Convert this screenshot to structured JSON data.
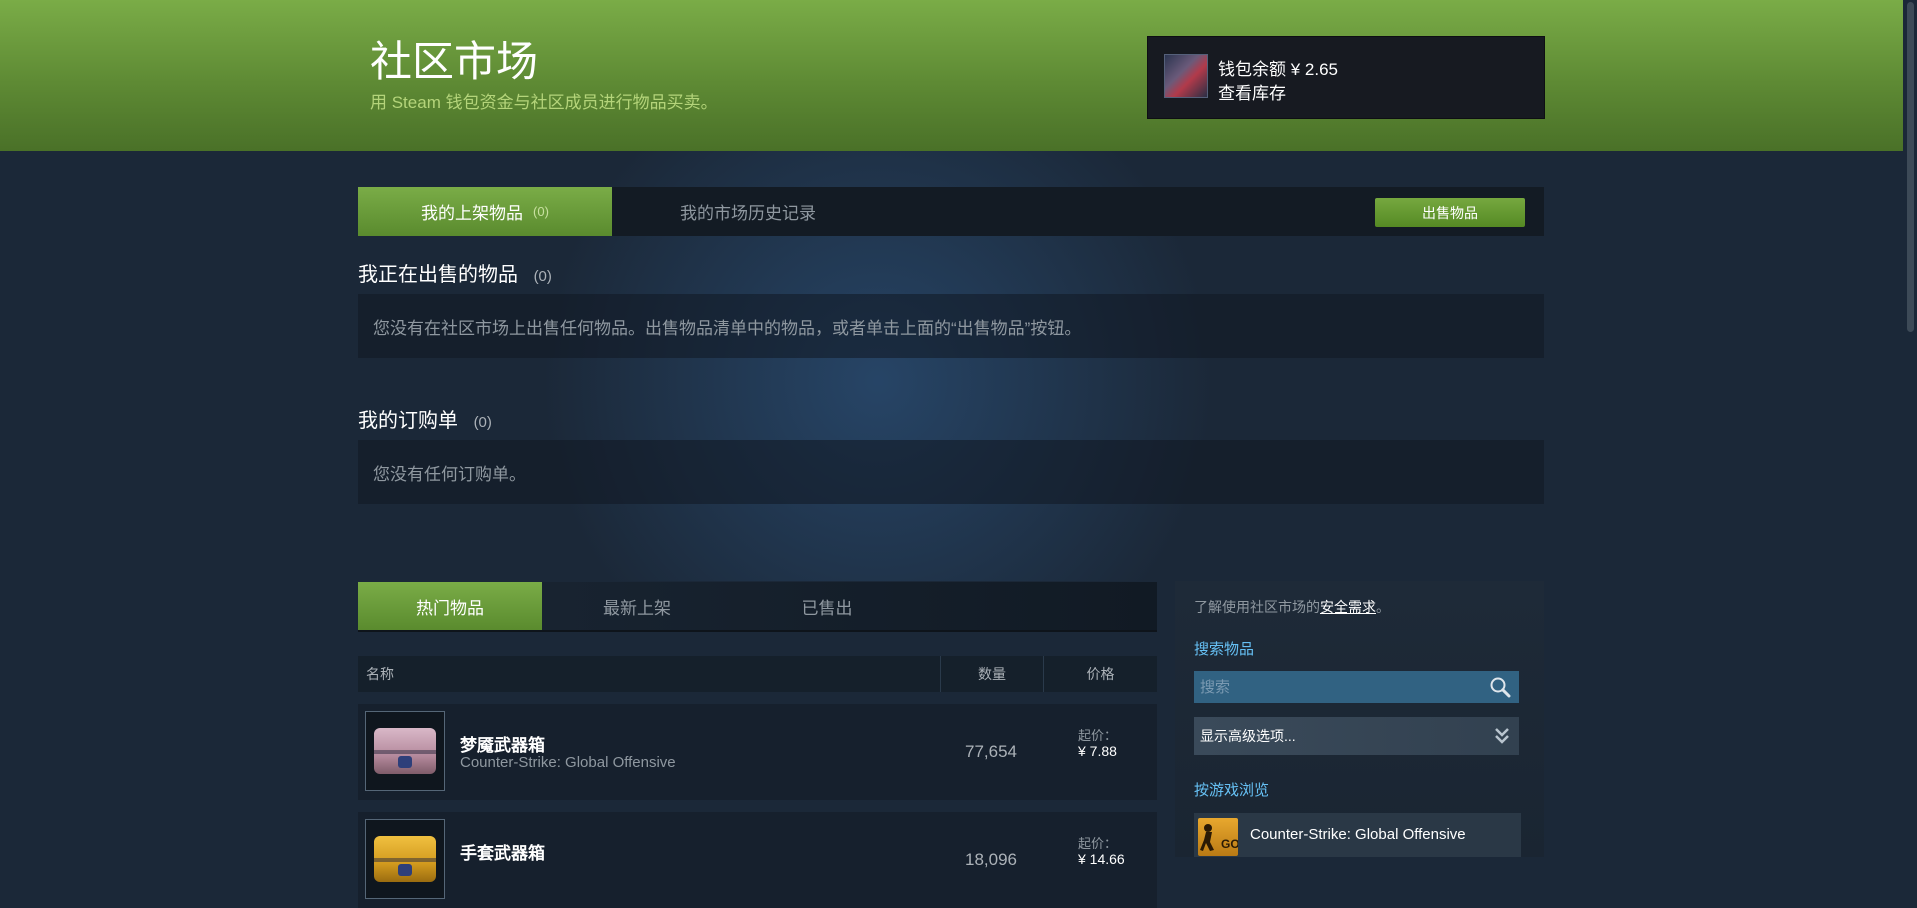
{
  "header": {
    "title": "社区市场",
    "subtitle": "用 Steam 钱包资金与社区成员进行物品买卖。",
    "wallet_label": "钱包余额 ¥ 2.65",
    "inventory_link": "查看库存"
  },
  "listing_tabs": {
    "my_listings": "我的上架物品",
    "my_listings_count": "(0)",
    "history": "我的市场历史记录",
    "sell_button": "出售物品"
  },
  "selling_section": {
    "title": "我正在出售的物品",
    "count": "(0)",
    "empty_message": "您没有在社区市场上出售任何物品。出售物品清单中的物品，或者单击上面的“出售物品”按钮。"
  },
  "orders_section": {
    "title": "我的订购单",
    "count": "(0)",
    "empty_message": "您没有任何订购单。"
  },
  "browse_tabs": {
    "popular": "热门物品",
    "newest": "最新上架",
    "sold": "已售出"
  },
  "table": {
    "col_name": "名称",
    "col_qty": "数量",
    "col_price": "价格",
    "rows": [
      {
        "name": "梦魇武器箱",
        "game": "Counter-Strike: Global Offensive",
        "qty": "77,654",
        "price_label": "起价：",
        "price": "¥ 7.88",
        "thumb_color": "pink"
      },
      {
        "name": "手套武器箱",
        "game": "",
        "qty": "18,096",
        "price_label": "起价：",
        "price": "¥ 14.66",
        "thumb_color": "gold"
      }
    ]
  },
  "sidebar": {
    "info_prefix": "了解使用社区市场的",
    "info_link": "安全需求",
    "info_suffix": "。",
    "search_heading": "搜索物品",
    "search_placeholder": "搜索",
    "advanced": "显示高级选项...",
    "browse_heading": "按游戏浏览",
    "game_icon_label": "GO",
    "game_name": "Counter-Strike: Global Offensive"
  },
  "colors": {
    "accent_green": "#7aac47",
    "link_blue": "#66c0f4",
    "background": "#1b2838"
  }
}
